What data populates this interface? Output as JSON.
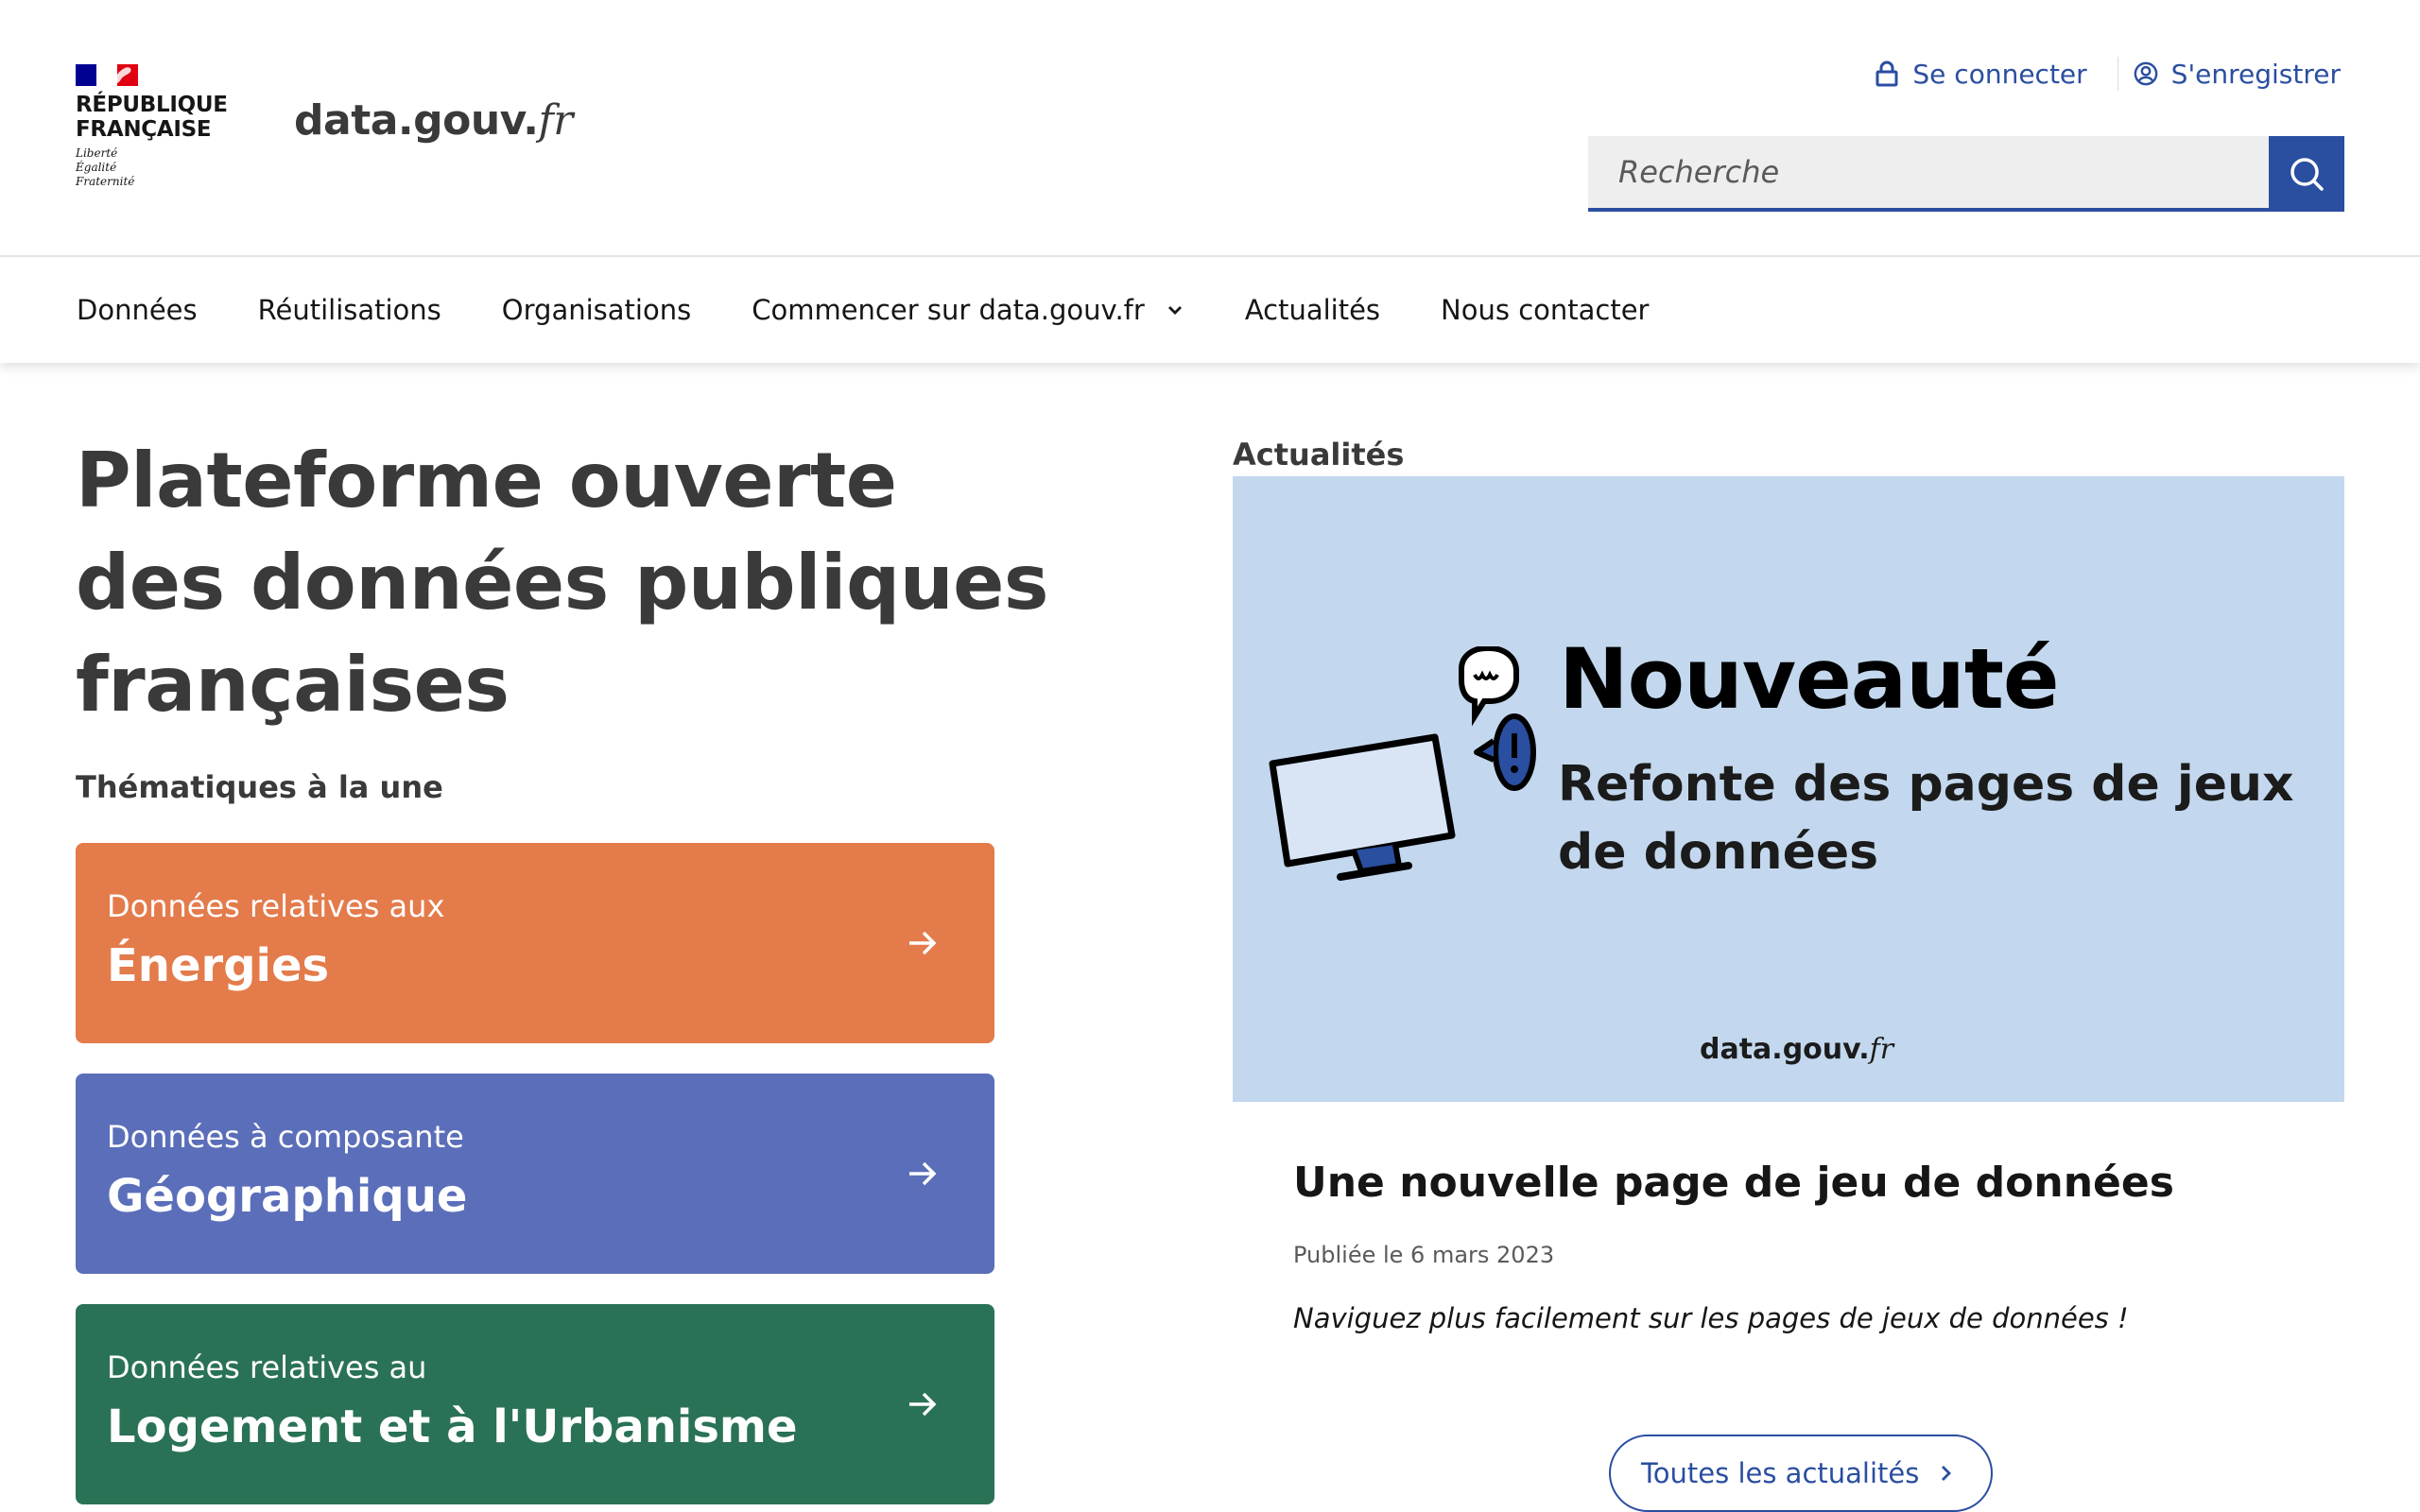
{
  "colors": {
    "brand_blue": "#2a4ea0",
    "flag_blue": "#000091",
    "flag_red": "#e1000f",
    "tile_energy": "#e47b4b",
    "tile_geo": "#5b6eb9",
    "tile_housing": "#2a7255",
    "banner_bg": "#c3d8ee"
  },
  "header": {
    "republic_line1": "RÉPUBLIQUE",
    "republic_line2": "FRANÇAISE",
    "motto_line1": "Liberté",
    "motto_line2": "Égalité",
    "motto_line3": "Fraternité",
    "site_name": "data.gouv.",
    "site_tld": "fr",
    "login_label": "Se connecter",
    "login_icon": "lock-icon",
    "register_label": "S'enregistrer",
    "register_icon": "user-icon"
  },
  "search": {
    "placeholder": "Recherche",
    "value": "",
    "button_icon": "search-icon"
  },
  "nav": {
    "items": [
      {
        "label": "Données"
      },
      {
        "label": "Réutilisations"
      },
      {
        "label": "Organisations"
      },
      {
        "label": "Commencer sur data.gouv.fr",
        "icon": "chevron-down-icon"
      },
      {
        "label": "Actualités"
      },
      {
        "label": "Nous contacter"
      }
    ]
  },
  "hero": {
    "title": "Plateforme ouverte des données publiques françaises"
  },
  "themes": {
    "heading": "Thématiques à la une",
    "tiles": [
      {
        "subtitle": "Données relatives aux",
        "title": "Énergies",
        "icon": "arrow-right-icon"
      },
      {
        "subtitle": "Données à composante",
        "title": "Géographique",
        "icon": "arrow-right-icon"
      },
      {
        "subtitle": "Données relatives au",
        "title": "Logement et à l'Urbanisme",
        "icon": "arrow-right-icon"
      }
    ]
  },
  "news": {
    "section_label": "Actualités",
    "banner_title": "Nouveauté",
    "banner_subtitle": "Refonte des pages de jeux de données",
    "banner_logo": "data.gouv.",
    "banner_logo_tld": "fr",
    "article_title": "Une nouvelle page de jeu de données",
    "article_date": "Publiée le 6 mars 2023",
    "article_description": "Naviguez plus facilement sur les pages de jeux de données !",
    "all_news_label": "Toutes les actualités",
    "all_news_icon": "chevron-right-icon"
  }
}
